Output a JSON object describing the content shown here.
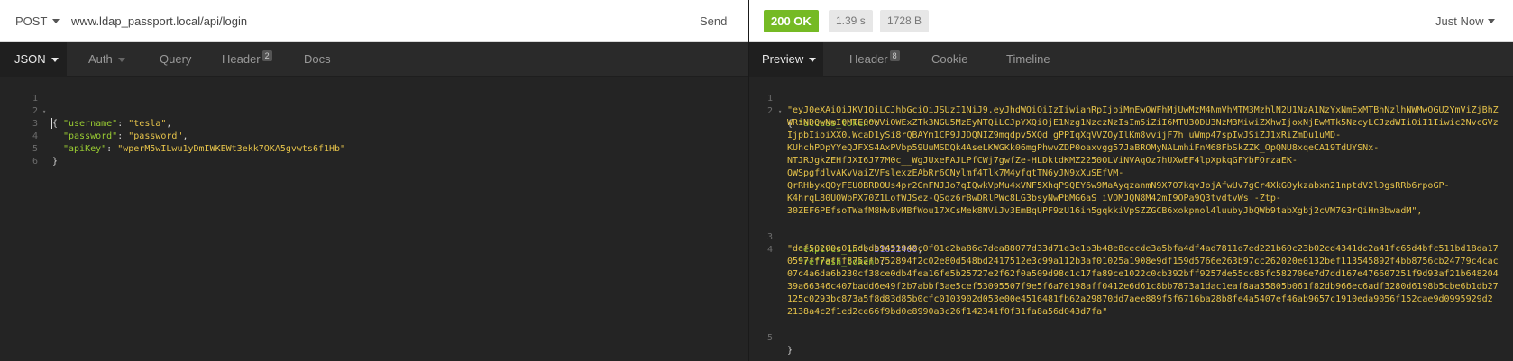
{
  "request": {
    "method": "POST",
    "url": "www.ldap_passport.local/api/login",
    "send_label": "Send",
    "tabs": [
      {
        "label": "JSON"
      },
      {
        "label": "Auth"
      },
      {
        "label": "Query"
      },
      {
        "label": "Header",
        "count": "2"
      },
      {
        "label": "Docs"
      }
    ],
    "body_lines": [
      {
        "n": "1",
        "text": "{"
      },
      {
        "n": "2",
        "key": "\"username\"",
        "value": "\"tesla\""
      },
      {
        "n": "3",
        "key": "\"password\"",
        "value": "\"password\""
      },
      {
        "n": "4",
        "key": "\"apiKey\"",
        "value": "\"wperM5wILwu1yDmIWKEWt3ekk7OKA5gvwts6f1Hb\""
      },
      {
        "n": "5",
        "text": "}"
      },
      {
        "n": "6",
        "text": ""
      }
    ]
  },
  "response": {
    "status": "200 OK",
    "time": "1.39 s",
    "size": "1728 B",
    "timestamp": "Just Now",
    "tabs": [
      {
        "label": "Preview"
      },
      {
        "label": "Header",
        "count": "8"
      },
      {
        "label": "Cookie"
      },
      {
        "label": "Timeline"
      }
    ],
    "ln": [
      "1",
      "2",
      "3",
      "4",
      "5"
    ],
    "open_brace": "{",
    "close_brace": "}",
    "access_token_key": "\"access_token\"",
    "access_token_lines": [
      "\"eyJ0eXAiOiJKV1QiLCJhbGciOiJSUzI1NiJ9.eyJhdWQiOiIzIiwianRpIjoiMmEwOWFhMjUwMzM4NmVhMTM3MzhlN2U1NzA1NzYxNmExMTBhNzlhNWMwOGU2YmViZjBhZ",
      "WRiNDQwNmI0MTE0OWViOWExZTk3NGU5MzEyNTQiLCJpYXQiOjE1Nzg1NzczNzIsIm5iZiI6MTU3ODU3NzM3MiwiZXhwIjoxNjEwMTk5NzcyLCJzdWIiOiI1Iiwic2NvcGVz",
      "IjpbIioiXX0.WcaD1ySi8rQBAYm1CP9JJDQNIZ9mqdpv5XQd_gPPIqXqVVZOyIlKm8vvijF7h_uWmp47spIwJSiZJ1xRiZmDu1uMD-",
      "KUhchPDpYYeQJFXS4AxPVbp59UuMSDQk4AseLKWGKk06mgPhwvZDP0oaxvgg57JaBROMyNALmhiFnM68FbSkZZK_OpQNU8xqeCA19TdUYSNx-",
      "NTJRJgkZEHfJXI6J77M0c__WgJUxeFAJLPfCWj7gwfZe-HLDktdKMZ2250OLViNVAqOz7hUXwEF4lpXpkqGFYbFOrzaEK-",
      "QWSpgfdlvAKvVaiZVFslexzEAbRr6CNylmf4Tlk7M4yfqtTN6yJN9xXuSEfVM-",
      "QrRHbyxQOyFEU0BRDOUs4pr2GnFNJJo7qIQwkVpMu4xVNF5XhqP9QEY6w9MaAyqzanmN9X7O7kqvJojAfwUv7gCr4XkGOykzabxn21nptdV2lDgsRRb6rpoGP-",
      "K4hrqL80UOWbPX70Z1LofWJSez-QSqz6rBwDRlPWc8LG3bsyNwPbMG6aS_iVOMJQN8M42mI9OPa9Q3tvdtvWs_-Ztp-",
      "30ZEF6PEfsoTWafM8HvBvMBfWou17XCsMek8NViJv3EmBqUPF9zU16in5gqkkiVpSZZGCB6xokpnol4luubyJbQWb9tabXgbj2cVM7G3rQiHnBbwadM\","
    ],
    "expires_in_key": "\"expires_in\"",
    "expires_in_value": "31622400",
    "refresh_token_key": "\"refresh_token\"",
    "refresh_token_lines": [
      "\"def50200e015dbdb9451948c0f01c2ba86c7dea88077d33d71e3e1b3b48e8cecde3a5bfa4df4ad7811d7ed221b60c23b02cd4341dc2a41fc65d4bfc511bd18da17",
      "0597ff7afff8752fb752894f2c02e80d548bd2417512e3c99a112b3af01025a1908e9df159d5766e263b97cc262020e0132bef113545892f4bb8756cb24779c4cac",
      "07c4a6da6b230cf38ce0db4fea16fe5b25727e2f62f0a509d98c1c17fa89ce1022c0cb392bff9257de55cc85fc582700e7d7dd167e476607251f9d93af21b648204",
      "39a66346c407badd6e49f2b7abbf3ae5cef53095507f9e5f6a70198aff0412e6d61c8bb7873a1dac1eaf8aa35805b061f82db966ec6adf3280d6198b5cbe6b1db27",
      "125c0293bc873a5f8d83d85b0cfc0103902d053e00e4516481fb62a29870dd7aee889f5f6716ba28b8fe4a5407ef46ab9657c1910eda9056f152cae9d0995929d2",
      "2138a4c2f1ed2ce66f9bd0e8990a3c26f142341f0f31fa8a56d043d7fa\""
    ]
  },
  "colors": {
    "status_ok": "#75ba24",
    "json_key": "#9acd32",
    "json_string": "#e6c34a",
    "json_number": "#9b8cff"
  }
}
